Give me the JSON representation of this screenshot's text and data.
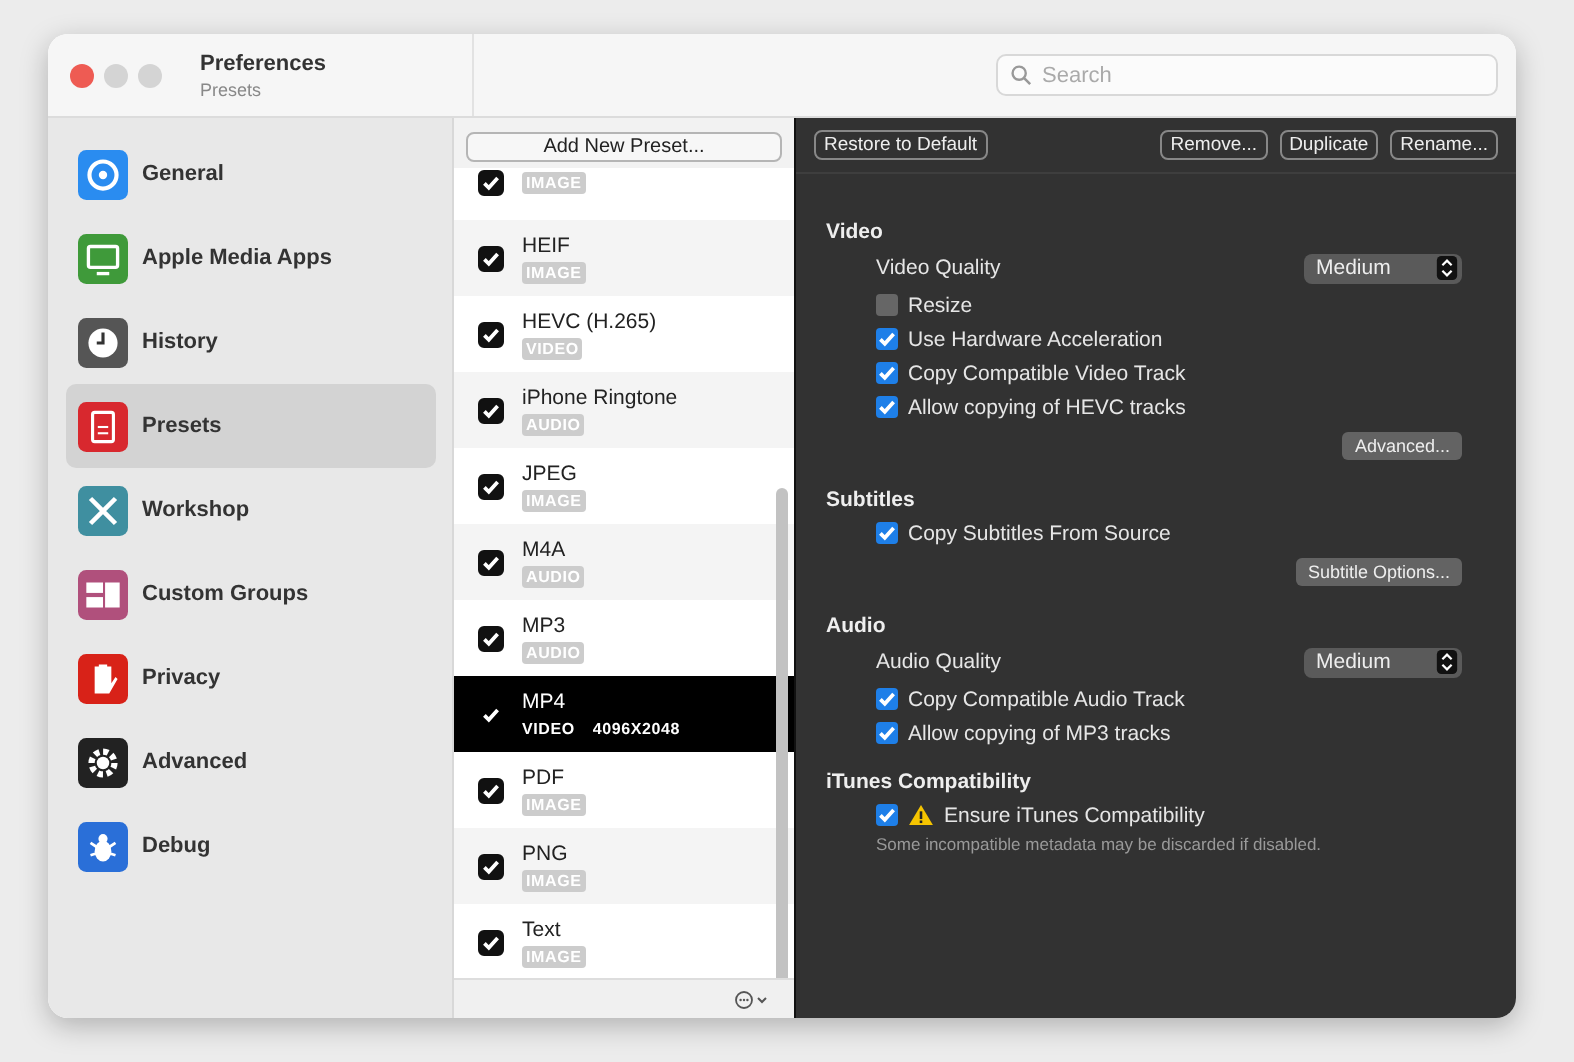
{
  "window": {
    "title": "Preferences",
    "subtitle": "Presets"
  },
  "search": {
    "placeholder": "Search"
  },
  "sidebar": {
    "items": [
      {
        "label": "General",
        "selected": false
      },
      {
        "label": "Apple Media Apps",
        "selected": false
      },
      {
        "label": "History",
        "selected": false
      },
      {
        "label": "Presets",
        "selected": true
      },
      {
        "label": "Workshop",
        "selected": false
      },
      {
        "label": "Custom Groups",
        "selected": false
      },
      {
        "label": "Privacy",
        "selected": false
      },
      {
        "label": "Advanced",
        "selected": false
      },
      {
        "label": "Debug",
        "selected": false
      }
    ]
  },
  "presets": {
    "add_button": "Add New Preset...",
    "items": [
      {
        "badge": "IMAGE",
        "checked": true,
        "selected": false
      },
      {
        "name": "HEIF",
        "badge": "IMAGE",
        "checked": true,
        "selected": false
      },
      {
        "name": "HEVC (H.265)",
        "badge": "VIDEO",
        "checked": true,
        "selected": false
      },
      {
        "name": "iPhone Ringtone",
        "badge": "AUDIO",
        "checked": true,
        "selected": false
      },
      {
        "name": "JPEG",
        "badge": "IMAGE",
        "checked": true,
        "selected": false
      },
      {
        "name": "M4A",
        "badge": "AUDIO",
        "checked": true,
        "selected": false
      },
      {
        "name": "MP3",
        "badge": "AUDIO",
        "checked": true,
        "selected": false
      },
      {
        "name": "MP4",
        "badge": "VIDEO",
        "detail": "4096X2048",
        "checked": true,
        "selected": true
      },
      {
        "name": "PDF",
        "badge": "IMAGE",
        "checked": true,
        "selected": false
      },
      {
        "name": "PNG",
        "badge": "IMAGE",
        "checked": true,
        "selected": false
      },
      {
        "name": "Text",
        "badge": "IMAGE",
        "checked": true,
        "selected": false
      }
    ]
  },
  "toolbar": {
    "left": [
      "Restore to Default"
    ],
    "right": [
      "Remove...",
      "Duplicate",
      "Rename..."
    ]
  },
  "sections": [
    {
      "title": "Video",
      "rows": [
        {
          "kind": "select",
          "label": "Video Quality",
          "value": "Medium"
        },
        {
          "kind": "checkbox",
          "label": "Resize",
          "checked": false
        },
        {
          "kind": "checkbox",
          "label": "Use Hardware Acceleration",
          "checked": true
        },
        {
          "kind": "checkbox",
          "label": "Copy Compatible Video Track",
          "checked": true
        },
        {
          "kind": "checkbox",
          "label": "Allow copying of HEVC tracks",
          "checked": true
        },
        {
          "kind": "button",
          "label": "Advanced..."
        }
      ]
    },
    {
      "title": "Subtitles",
      "rows": [
        {
          "kind": "checkbox",
          "label": "Copy Subtitles From Source",
          "checked": true
        },
        {
          "kind": "button",
          "label": "Subtitle Options..."
        }
      ]
    },
    {
      "title": "Audio",
      "rows": [
        {
          "kind": "select",
          "label": "Audio Quality",
          "value": "Medium"
        },
        {
          "kind": "checkbox",
          "label": "Copy Compatible Audio Track",
          "checked": true
        },
        {
          "kind": "checkbox",
          "label": "Allow copying of MP3 tracks",
          "checked": true
        }
      ]
    },
    {
      "title": "iTunes Compatibility",
      "rows": [
        {
          "kind": "checkbox",
          "label": "Ensure iTunes Compatibility",
          "checked": true,
          "warning": true
        },
        {
          "kind": "note",
          "label": "Some incompatible metadata may be discarded if disabled."
        }
      ]
    }
  ]
}
